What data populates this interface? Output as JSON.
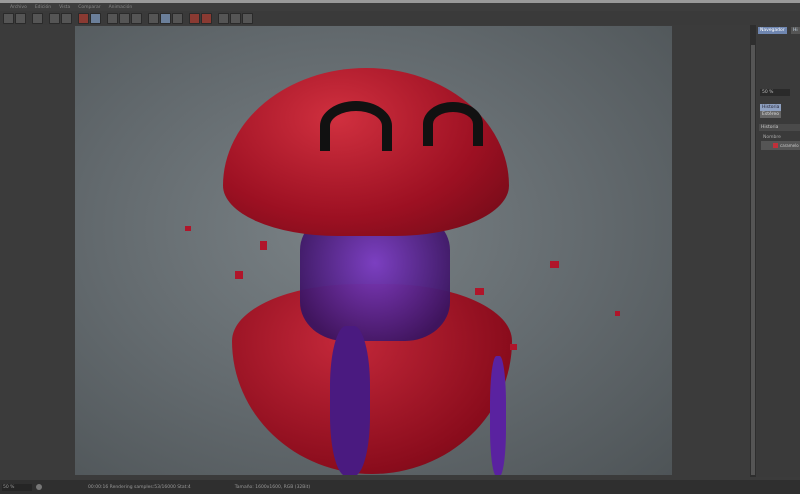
{
  "menu": [
    "Archivo",
    "Edición",
    "Vista",
    "Comparar",
    "Animación"
  ],
  "panel": {
    "tabs": [
      "Navegador",
      "Hi"
    ],
    "zoom": "50 %",
    "subtabs": [
      "Historia",
      "Estéreo"
    ],
    "section": "Historia",
    "column": "Nombre",
    "items": [
      "caramelo"
    ]
  },
  "status": {
    "zoom": "50 %",
    "render_info": "00:00:16 Rendering samples:53/16000 Stat:4",
    "size_info": "Tamaño: 1600x1600, RGB (32Bit)"
  },
  "colors": {
    "accent_tab": "#6f86b0",
    "candy_red": "#b0152a",
    "goo_purple": "#5a1a9a"
  }
}
